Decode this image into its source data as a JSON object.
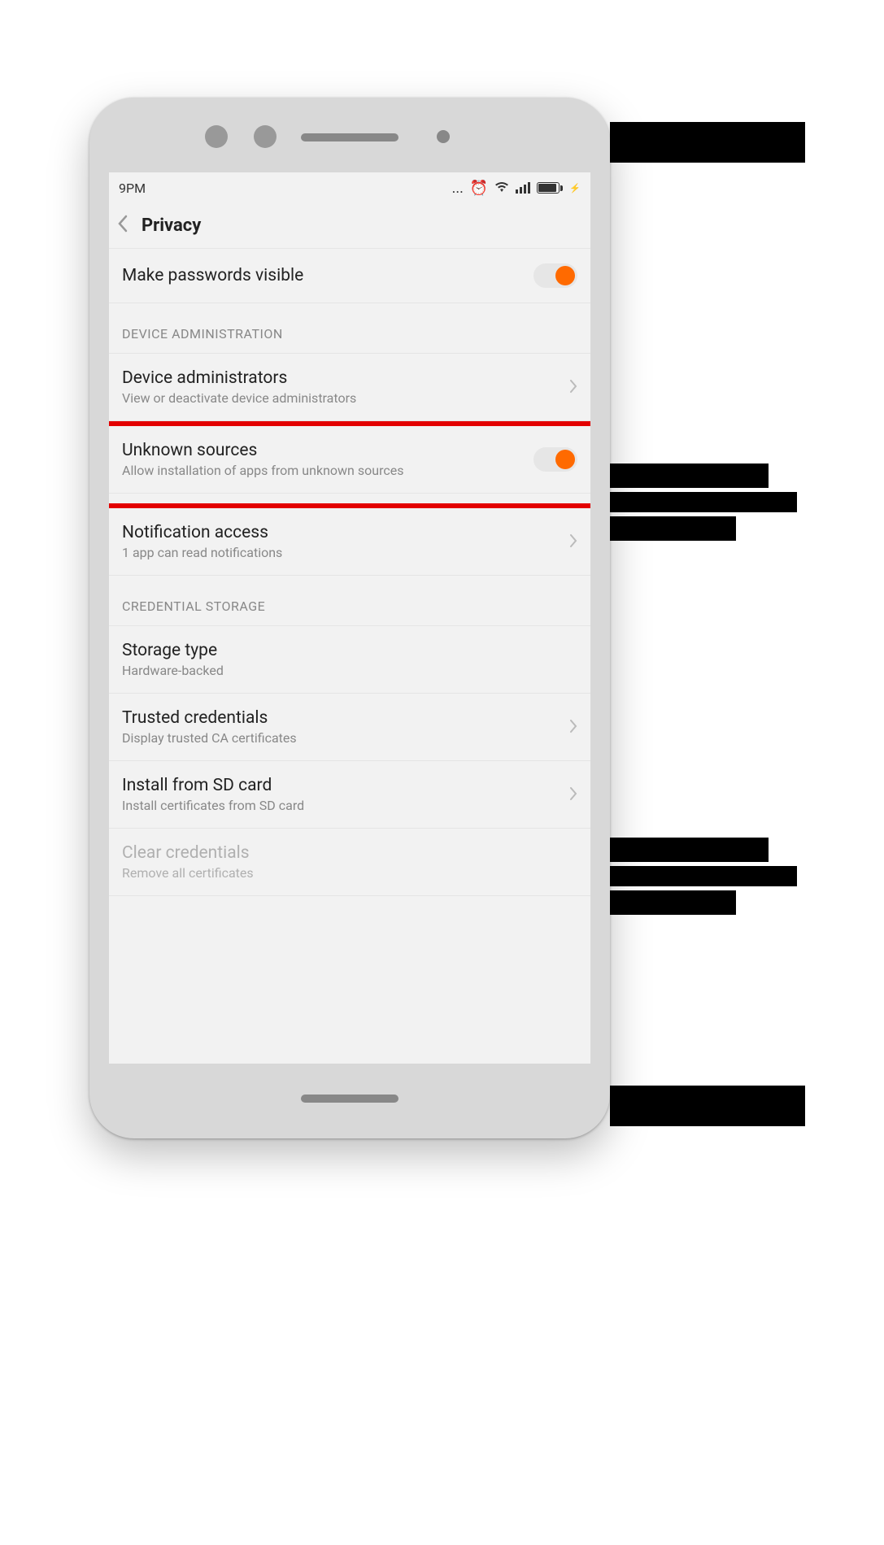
{
  "status_bar": {
    "time": "9PM",
    "dots": "...",
    "charging": "⚡"
  },
  "header": {
    "title": "Privacy"
  },
  "items": {
    "passwords": {
      "title": "Make passwords visible"
    },
    "section_device_admin": "DEVICE ADMINISTRATION",
    "device_admins": {
      "title": "Device administrators",
      "sub": "View or deactivate device administrators"
    },
    "unknown_sources": {
      "title": "Unknown sources",
      "sub": "Allow installation of apps from unknown sources"
    },
    "notification_access": {
      "title": "Notification access",
      "sub": "1 app can read notifications"
    },
    "section_cred": "CREDENTIAL STORAGE",
    "storage_type": {
      "title": "Storage type",
      "sub": "Hardware-backed"
    },
    "trusted_creds": {
      "title": "Trusted credentials",
      "sub": "Display trusted CA certificates"
    },
    "install_sd": {
      "title": "Install from SD card",
      "sub": "Install certificates from SD card"
    },
    "clear_creds": {
      "title": "Clear credentials",
      "sub": "Remove all certificates"
    }
  }
}
